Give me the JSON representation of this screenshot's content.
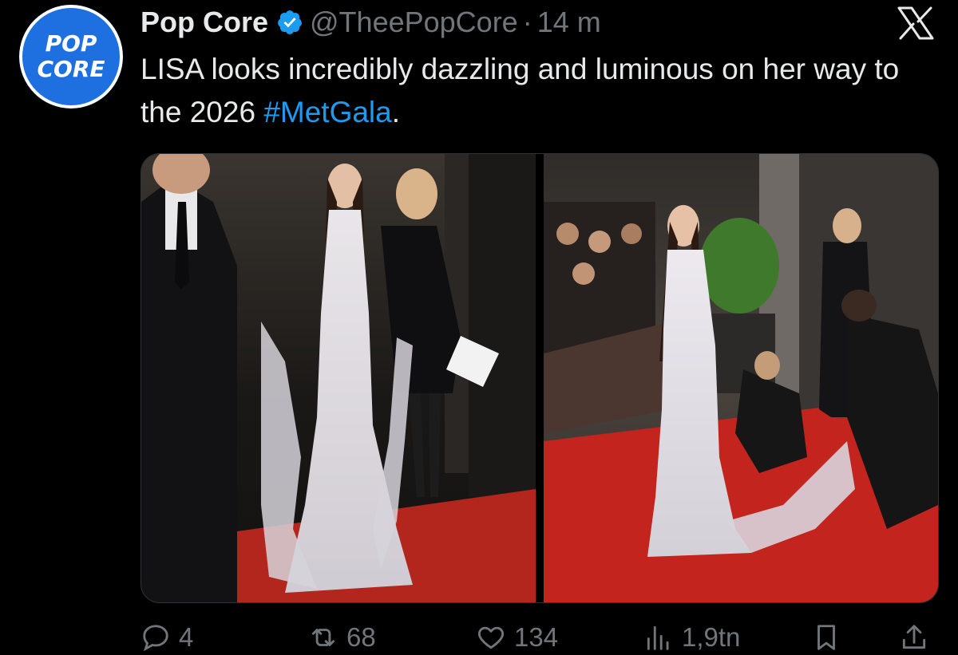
{
  "account": {
    "avatar_text_line1": "POP",
    "avatar_text_line2": "CORE",
    "display_name": "Pop Core",
    "handle": "@TheePopCore",
    "separator": "·",
    "time": "14 m",
    "verified_icon": "verified-badge-icon",
    "brand_color": "#1e6fe0"
  },
  "platform": {
    "logo_icon": "x-logo-icon"
  },
  "tweet": {
    "text_part1": "LISA looks incredibly dazzling and luminous on her way to the 2026 ",
    "hashtag": "#MetGala",
    "text_part2": ".",
    "hashtag_color": "#1d9bf0"
  },
  "media": [
    {
      "icon": "photo-left",
      "alt": ""
    },
    {
      "icon": "photo-right",
      "alt": ""
    }
  ],
  "actions": {
    "reply": {
      "icon": "reply-icon",
      "count": "4"
    },
    "retweet": {
      "icon": "retweet-icon",
      "count": "68"
    },
    "like": {
      "icon": "heart-icon",
      "count": "134"
    },
    "views": {
      "icon": "views-icon",
      "count": "1,9tn"
    },
    "bookmark": {
      "icon": "bookmark-icon"
    },
    "share": {
      "icon": "share-icon"
    }
  }
}
